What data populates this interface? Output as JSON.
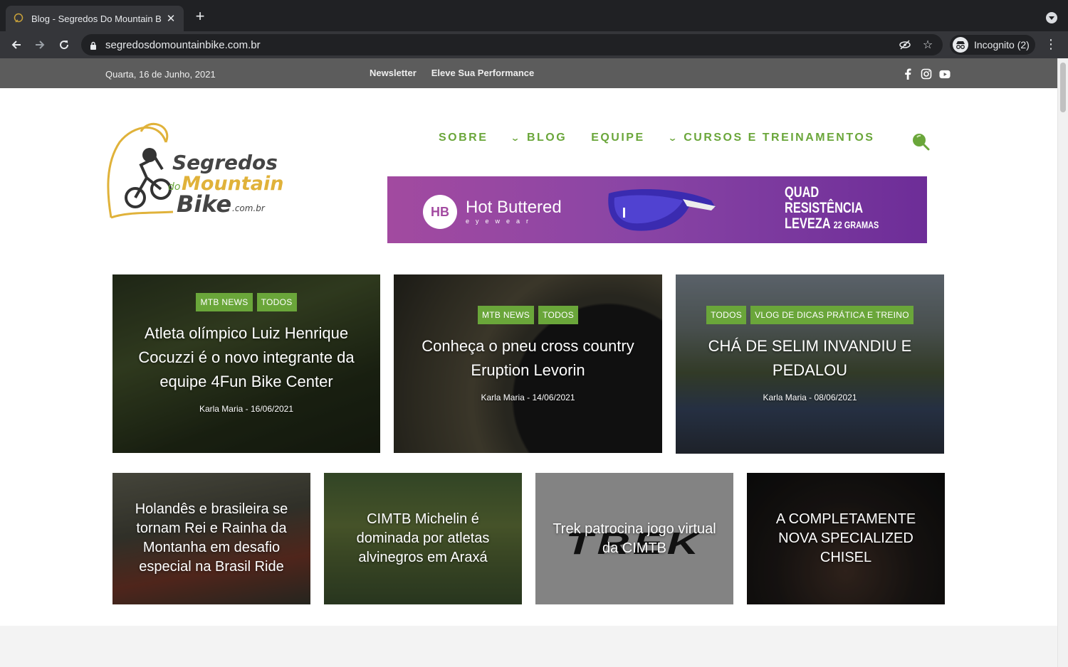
{
  "browser": {
    "tab_title": "Blog - Segredos Do Mountain B",
    "url": "segredosdomountainbike.com.br",
    "incognito_label": "Incognito (2)"
  },
  "topbar": {
    "date": "Quarta, 16 de Junho, 2021",
    "links": [
      "Newsletter",
      "Eleve Sua Performance"
    ]
  },
  "logo": {
    "line1": "Segredos",
    "line2_small": "do",
    "line2": "Mountain",
    "line3": "Bike",
    "line3_suffix": ".com.br"
  },
  "nav": {
    "items": [
      "SOBRE",
      "BLOG",
      "EQUIPE",
      "CURSOS E TREINAMENTOS"
    ]
  },
  "banner": {
    "logo_text": "HB",
    "brand": "Hot Buttered",
    "brand_sub": "eyewear",
    "tag_line1": "QUAD",
    "tag_line2": "RESISTÊNCIA",
    "tag_line3": "LEVEZA",
    "tag_small": "22 GRAMAS"
  },
  "featured": [
    {
      "cats": [
        "MTB NEWS",
        "TODOS"
      ],
      "title": "Atleta olímpico Luiz Henrique Cocuzzi é o novo integrante da equipe 4Fun Bike Center",
      "meta": "Karla Maria - 16/06/2021"
    },
    {
      "cats": [
        "MTB NEWS",
        "TODOS"
      ],
      "title": "Conheça o pneu cross country Eruption Levorin",
      "meta": "Karla Maria - 14/06/2021"
    },
    {
      "cats": [
        "TODOS",
        "VLOG DE DICAS PRÁTICA E TREINO"
      ],
      "title": "CHÁ DE SELIM INVANDIU E PEDALOU",
      "meta": "Karla Maria - 08/06/2021"
    }
  ],
  "secondary": [
    {
      "title": "Holandês e brasileira se tornam Rei e Rainha da Montanha em desafio especial na Brasil Ride"
    },
    {
      "title": "CIMTB Michelin é dominada por atletas alvinegros em Araxá"
    },
    {
      "title": "Trek patrocina jogo virtual da CIMTB",
      "bg_word": "TREK"
    },
    {
      "title": "A COMPLETAMENTE NOVA SPECIALIZED CHISEL"
    }
  ],
  "colors": {
    "accent": "#6aa63a",
    "topbar": "#5c5c5c",
    "banner": "#8a45a5"
  }
}
